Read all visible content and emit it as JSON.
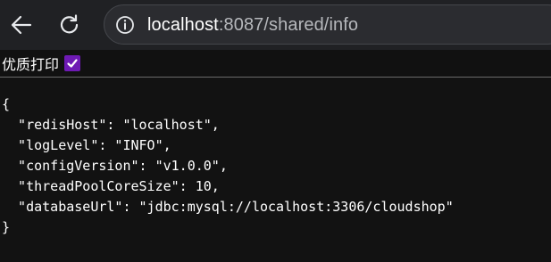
{
  "browser": {
    "url_host": "localhost",
    "url_rest": ":8087/shared/info"
  },
  "toolbar": {
    "pretty_print_label": "优质打印",
    "pretty_print_checked": true
  },
  "json_lines": [
    "{",
    "  \"redisHost\": \"localhost\",",
    "  \"logLevel\": \"INFO\",",
    "  \"configVersion\": \"v1.0.0\",",
    "  \"threadPoolCoreSize\": 10,",
    "  \"databaseUrl\": \"jdbc:mysql://localhost:3306/cloudshop\"",
    "}"
  ],
  "colors": {
    "checkbox_accent": "#6e1ab4",
    "browser_chrome": "#202124",
    "page_background": "#121212"
  }
}
